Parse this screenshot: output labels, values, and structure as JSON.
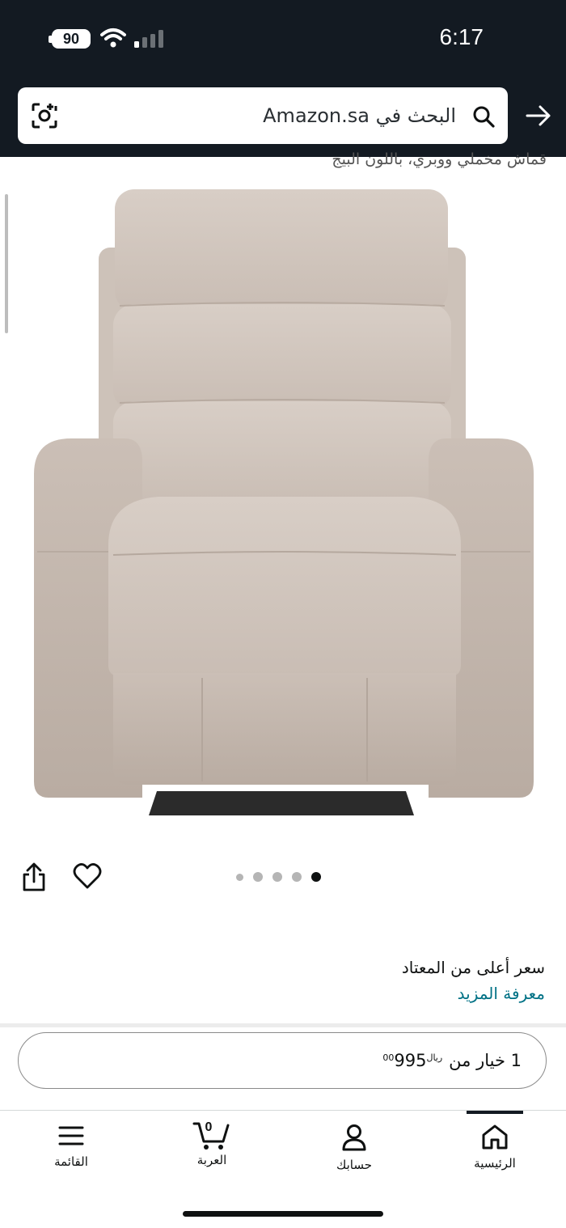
{
  "status_bar": {
    "battery": "90",
    "time": "6:17"
  },
  "search": {
    "placeholder": "البحث في Amazon.sa"
  },
  "product": {
    "title_fragment": "قماش مخملي ووبري، باللون البيج",
    "image_dots": {
      "total": 5,
      "active_index": 4
    }
  },
  "pricing": {
    "note": "سعر أعلى من المعتاد",
    "learn_more": "معرفة المزيد"
  },
  "offer": {
    "label": "1 خيار من",
    "currency": "ريال",
    "amount": "995",
    "fraction": "00"
  },
  "bottom_nav": {
    "items": [
      {
        "label": "الرئيسية",
        "icon": "home-icon"
      },
      {
        "label": "حسابك",
        "icon": "account-icon"
      },
      {
        "label": "العربة",
        "icon": "cart-icon",
        "count": "0"
      },
      {
        "label": "القائمة",
        "icon": "menu-icon"
      }
    ]
  },
  "colors": {
    "header_bg": "#131a22",
    "link": "#007185",
    "text": "#0f1111"
  }
}
